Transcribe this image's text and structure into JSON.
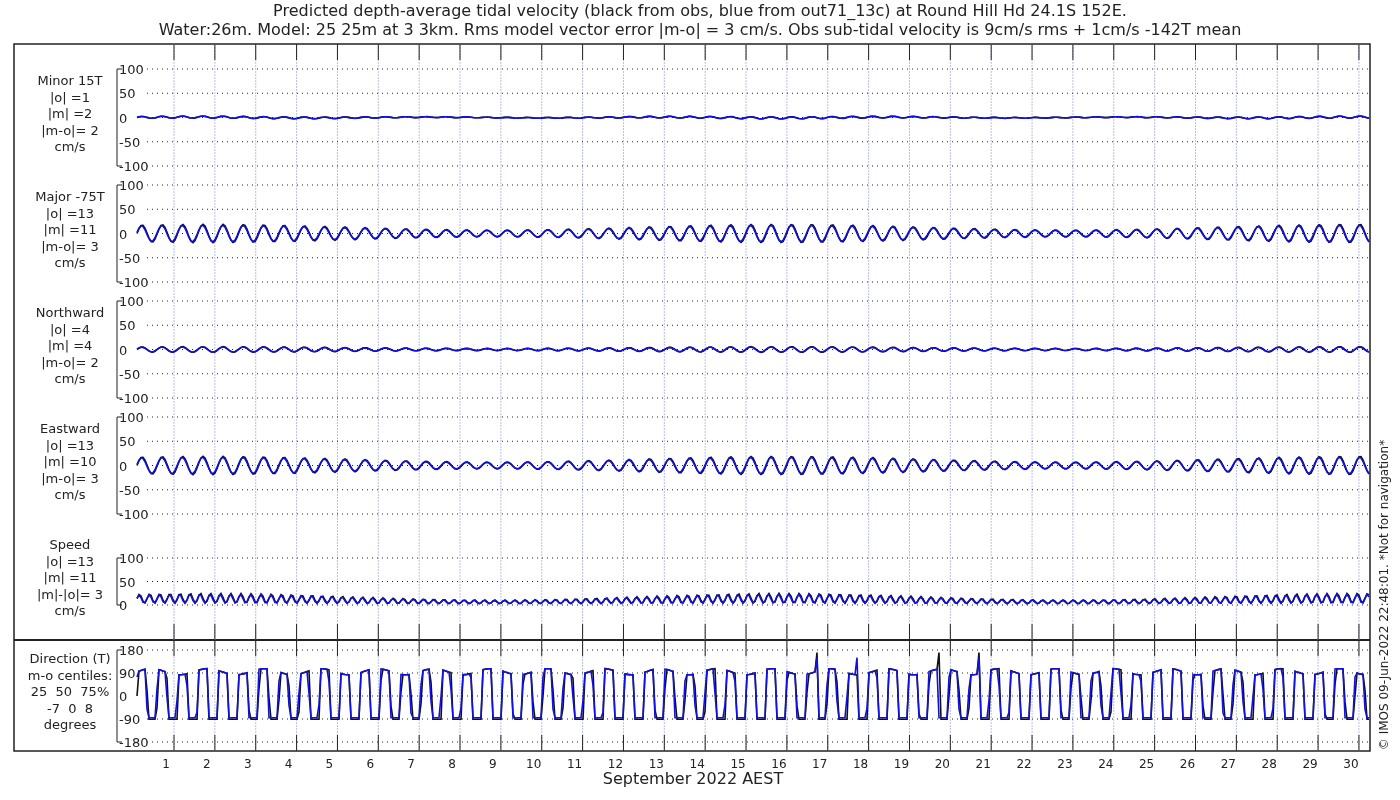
{
  "title": [
    "Predicted depth-average tidal velocity (black from obs, blue from out71_13c) at Round Hill Hd 24.1S 152E.",
    "Water:26m. Model: 25 25m at 3 3km. Rms model vector error |m-o| = 3 cm/s. Obs sub-tidal velocity is 9cm/s rms + 1cm/s -142T mean"
  ],
  "panels": [
    {
      "kind": "velocity",
      "labels": [
        "Minor 15T",
        "|o| =1",
        "|m| =2",
        "|m-o|= 2",
        "cm/s"
      ],
      "yticks": [
        "100",
        "50",
        "0",
        "-50",
        "-100"
      ]
    },
    {
      "kind": "velocity",
      "labels": [
        "Major -75T",
        "|o| =13",
        "|m| =11",
        "|m-o|= 3",
        "cm/s"
      ],
      "yticks": [
        "100",
        "50",
        "0",
        "-50",
        "-100"
      ]
    },
    {
      "kind": "velocity",
      "labels": [
        "Northward",
        "|o| =4",
        "|m| =4",
        "|m-o|= 2",
        "cm/s"
      ],
      "yticks": [
        "100",
        "50",
        "0",
        "-50",
        "-100"
      ]
    },
    {
      "kind": "velocity",
      "labels": [
        "Eastward",
        "|o| =13",
        "|m| =10",
        "|m-o|= 3",
        "cm/s"
      ],
      "yticks": [
        "100",
        "50",
        "0",
        "-50",
        "-100"
      ]
    },
    {
      "kind": "speed",
      "labels": [
        "Speed",
        "|o| =13",
        "|m| =11",
        "|m|-|o|= 3",
        "cm/s"
      ],
      "yticks": [
        "100",
        "50",
        "0"
      ]
    },
    {
      "kind": "direction",
      "labels": [
        "Direction (T)",
        "m-o centiles:",
        "25  50  75%",
        "-7  0  8",
        "degrees"
      ],
      "yticks": [
        "180",
        "90",
        "0",
        "-90",
        "-180"
      ]
    }
  ],
  "xaxis": {
    "ticks": [
      "1",
      "2",
      "3",
      "4",
      "5",
      "6",
      "7",
      "8",
      "9",
      "10",
      "11",
      "12",
      "13",
      "14",
      "15",
      "16",
      "17",
      "18",
      "19",
      "20",
      "21",
      "22",
      "23",
      "24",
      "25",
      "26",
      "27",
      "28",
      "29",
      "30"
    ],
    "label": "September 2022 AEST"
  },
  "credit": "© IMOS 09-Jun-2022 22:48:01. *Not for navigation*"
}
